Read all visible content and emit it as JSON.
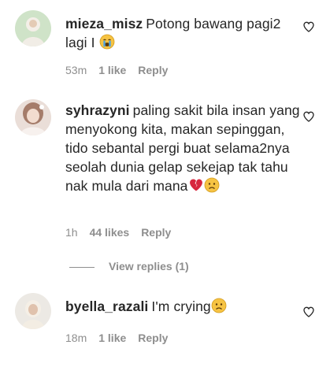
{
  "comments": [
    {
      "username": "mieza_misz",
      "text": "Potong bawang pagi2 lagi I",
      "emoji": "loudly-crying-face",
      "time": "53m",
      "likes": "1 like",
      "reply": "Reply"
    },
    {
      "username": "syhrazyni",
      "text": "paling sakit bila insan yang menyokong kita, makan sepinggan, tido sebantal pergi buat selama2nya seolah dunia gelap sekejap tak tahu nak mula dari mana",
      "emoji": [
        "broken-heart",
        "sad-face"
      ],
      "time": "1h",
      "likes": "44 likes",
      "reply": "Reply",
      "view_replies": "View replies (1)"
    },
    {
      "username": "byella_razali",
      "text": "I'm crying",
      "emoji": "sad-face",
      "time": "18m",
      "likes": "1 like",
      "reply": "Reply"
    }
  ],
  "colors": {
    "text": "#262626",
    "secondary": "#8e8e8e",
    "broken_heart": "#d7263d",
    "emoji_yellow": "#f6c343"
  }
}
